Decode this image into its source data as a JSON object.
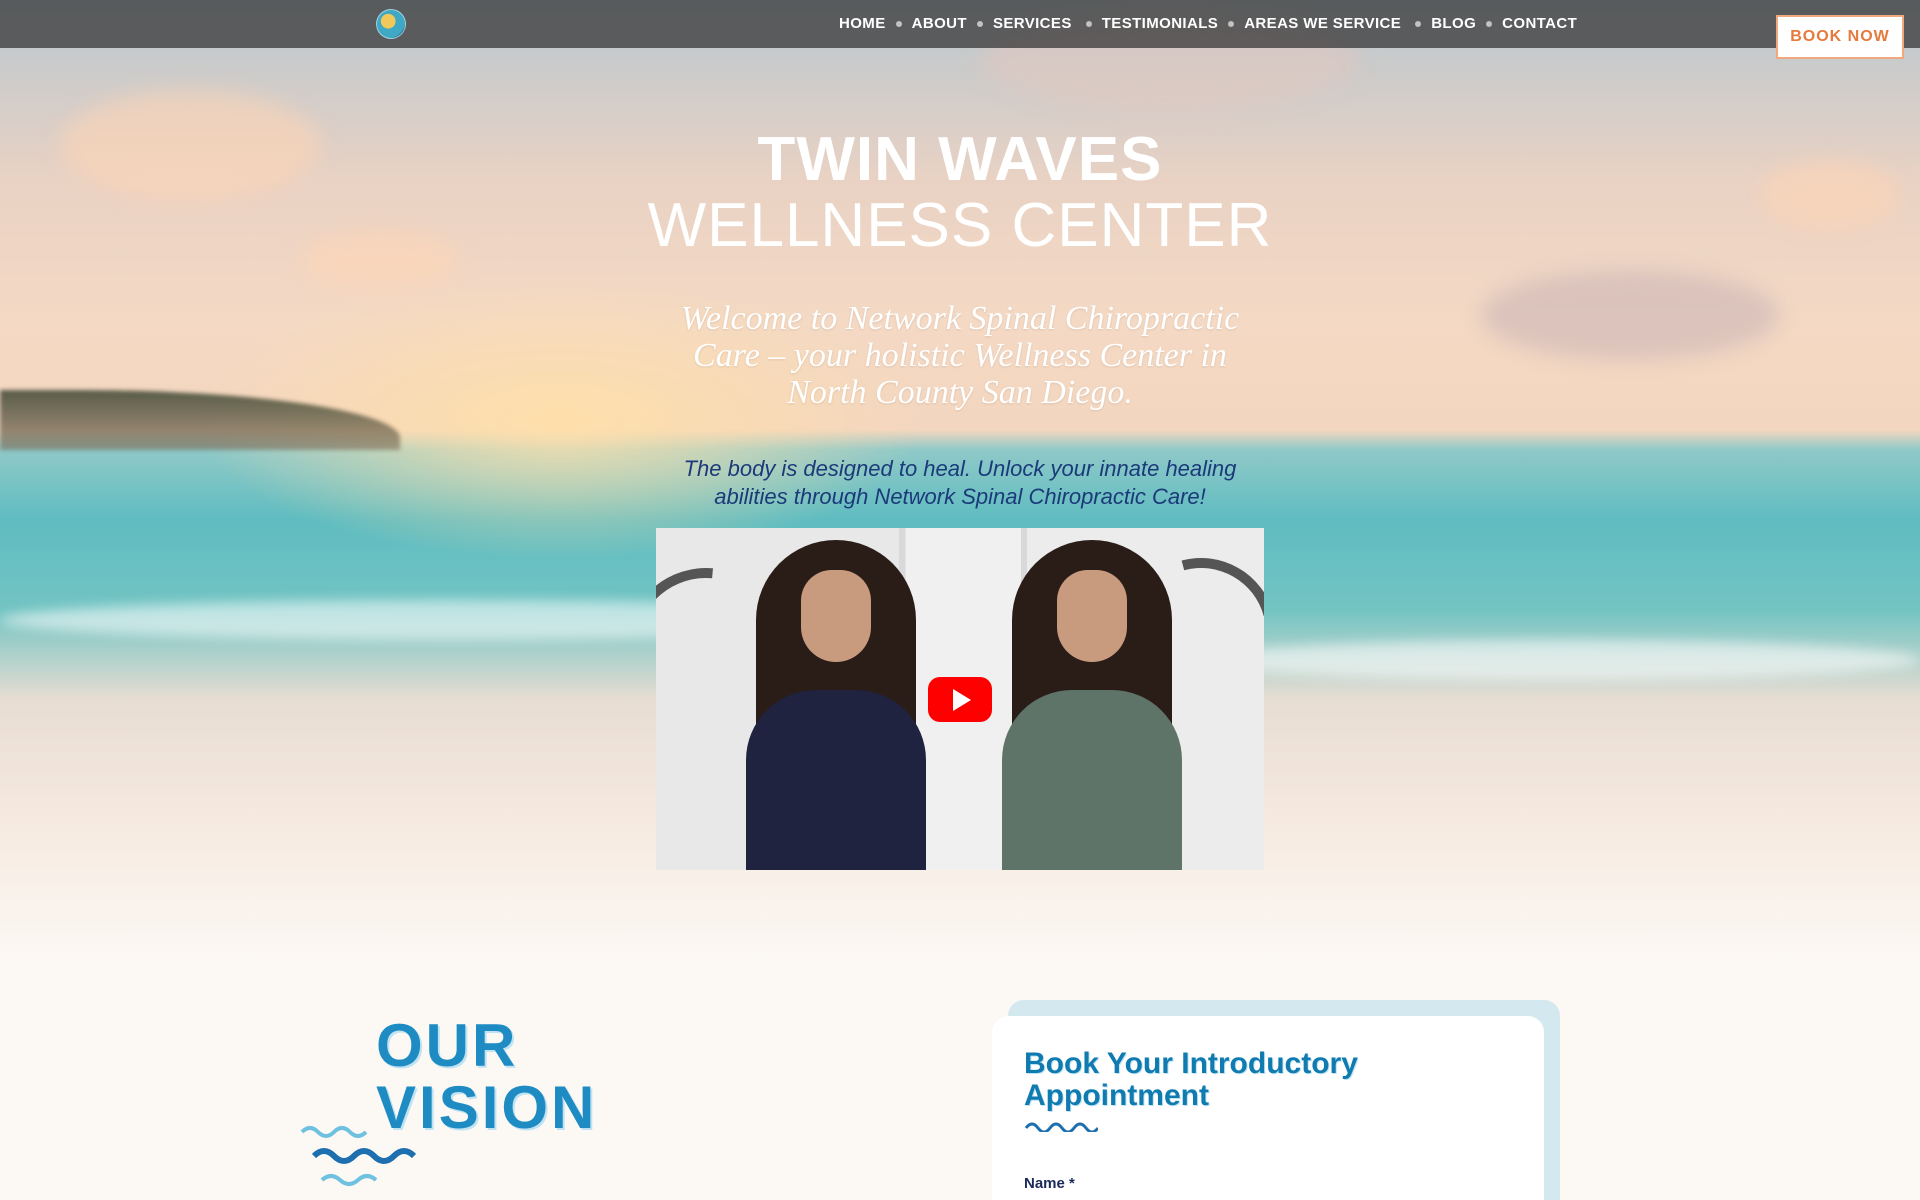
{
  "nav": {
    "links": [
      "HOME",
      "ABOUT",
      "SERVICES",
      "TESTIMONIALS",
      "AREAS WE SERVICE",
      "BLOG",
      "CONTACT"
    ],
    "book_label": "BOOK NOW"
  },
  "hero": {
    "title_line1": "TWIN WAVES",
    "title_line2": "WELLNESS CENTER",
    "welcome": "Welcome to Network Spinal Chiropractic Care – your holistic Wellness Center in North County San Diego.",
    "tagline": "The body is designed to heal. Unlock your innate healing abilities through Network Spinal Chiropractic Care!"
  },
  "vision": {
    "line1": "OUR",
    "line2": "VISION"
  },
  "form": {
    "title": "Book Your Introductory Appointment",
    "name_label": "Name *"
  },
  "colors": {
    "accent_orange": "#e57a3c",
    "brand_blue": "#1e8bc3",
    "navy": "#1b3a7a",
    "youtube_red": "#ff0000"
  }
}
